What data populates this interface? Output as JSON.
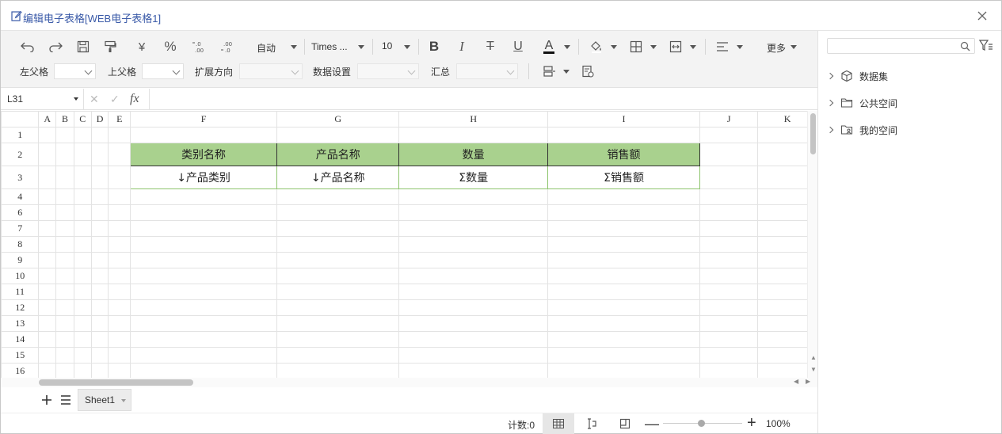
{
  "window": {
    "title": "编辑电子表格[WEB电子表格1]",
    "close_icon": "close-icon"
  },
  "toolbar": {
    "row1": {
      "undo_icon": "undo-icon",
      "redo_icon": "redo-icon",
      "save_icon": "save-icon",
      "format_painter_icon": "format-painter-icon",
      "currency_label": "¥",
      "percent_label": "%",
      "decimal_increase_label": "←.0\n.00",
      "decimal_decrease_label": ".00\n→.0",
      "number_format_value": "自动",
      "font_family_value": "Times ...",
      "font_size_value": "10",
      "bold_label": "B",
      "italic_label": "I",
      "strike_label": "T",
      "underline_label": "U",
      "font_color_label": "A",
      "fill_icon": "fill-color-icon",
      "border_icon": "border-icon",
      "merge_icon": "merge-icon",
      "align_icon": "align-left-icon",
      "more_label": "更多"
    },
    "row2": {
      "left_parent_label": "左父格",
      "top_parent_label": "上父格",
      "expand_dir_label": "扩展方向",
      "data_settings_label": "数据设置",
      "summary_label": "汇总",
      "insert_icon": "insert-row-icon",
      "cell_props_icon": "cell-properties-icon"
    }
  },
  "formula_bar": {
    "cell_ref": "L31",
    "cancel_icon": "cancel-icon",
    "confirm_icon": "confirm-icon",
    "fx_label": "fx",
    "formula_value": ""
  },
  "sheet": {
    "columns": [
      "A",
      "B",
      "C",
      "D",
      "E",
      "F",
      "G",
      "H",
      "I",
      "J",
      "K"
    ],
    "rows": [
      "1",
      "2",
      "3",
      "4",
      "6",
      "7",
      "8",
      "9",
      "10",
      "11",
      "12",
      "13",
      "14",
      "15",
      "16"
    ],
    "header_row": [
      "类别名称",
      "产品名称",
      "数量",
      "销售额"
    ],
    "template_row": [
      "↓产品类别",
      "↓产品名称",
      "Σ数量",
      "Σ销售额"
    ],
    "colors": {
      "header_fill": "#a9d18e",
      "template_border": "#8dc46c"
    }
  },
  "sheet_tabs": {
    "add_icon": "add-sheet-icon",
    "list_icon": "sheet-list-icon",
    "tabs": [
      {
        "label": "Sheet1"
      }
    ]
  },
  "status": {
    "count_label": "计数:0",
    "zoom_value": "100%",
    "zoom_level": 0.5
  },
  "right_panel": {
    "search_placeholder": "",
    "tree": [
      {
        "label": "数据集",
        "icon": "cube-icon"
      },
      {
        "label": "公共空间",
        "icon": "folder-icon"
      },
      {
        "label": "我的空间",
        "icon": "user-folder-icon"
      }
    ]
  }
}
